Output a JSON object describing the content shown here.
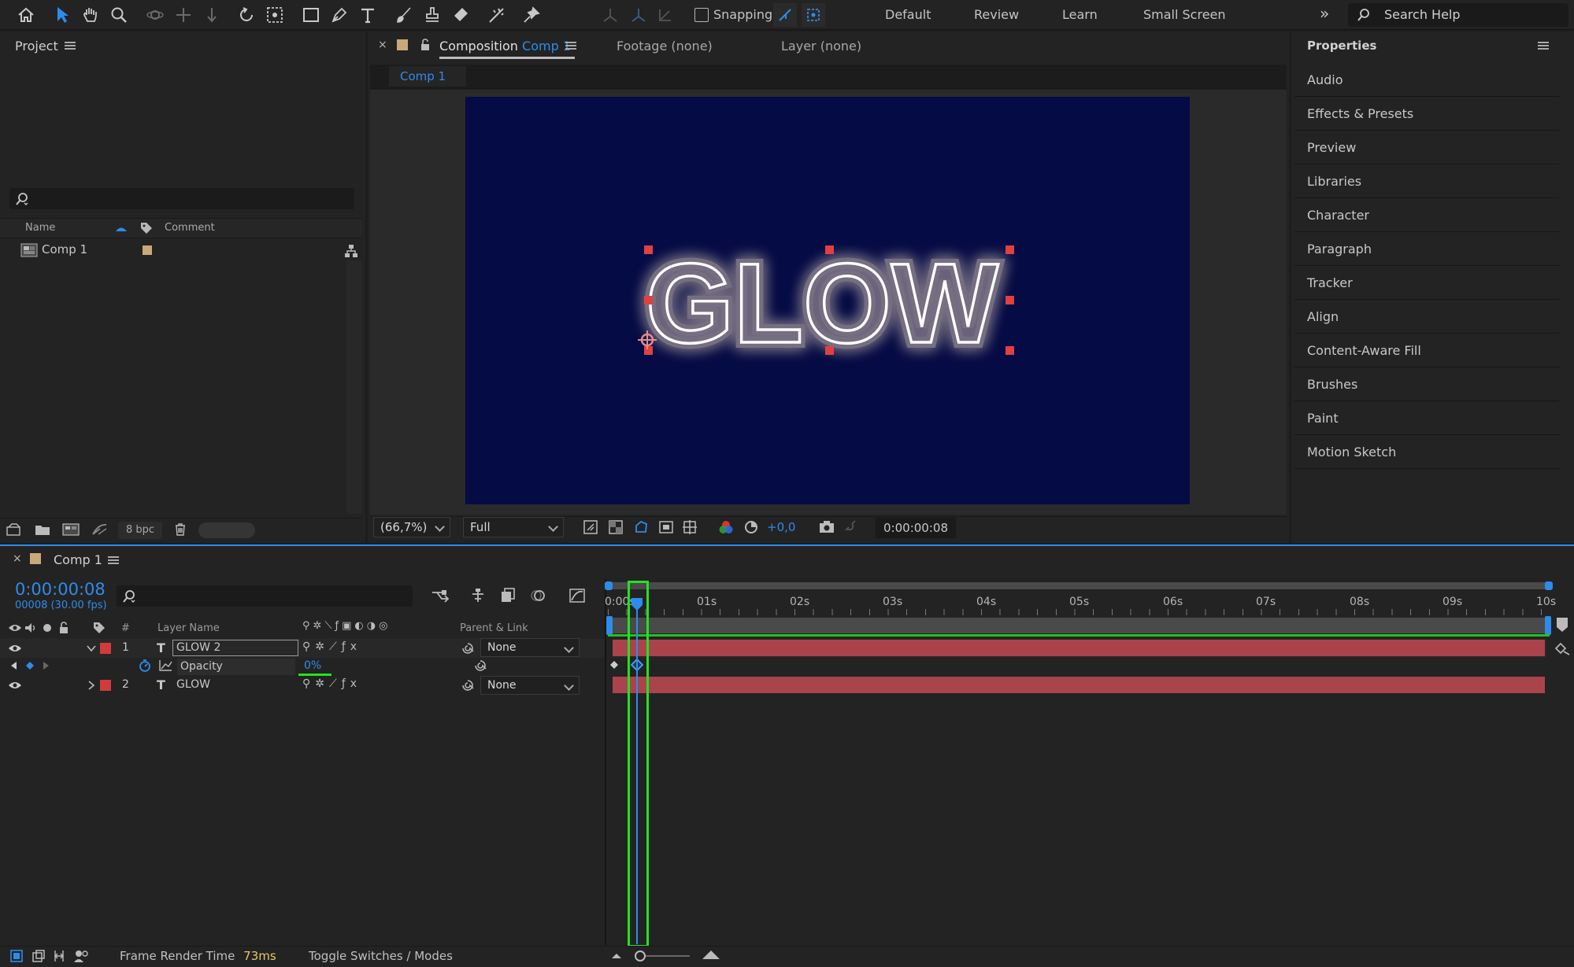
{
  "toolbar": {
    "snapping_label": "Snapping",
    "workspaces": [
      "Default",
      "Review",
      "Learn",
      "Small Screen"
    ],
    "search_placeholder": "Search Help"
  },
  "project": {
    "title": "Project",
    "col_name": "Name",
    "col_comment": "Comment",
    "items": [
      {
        "name": "Comp 1"
      }
    ],
    "bpc": "8 bpc"
  },
  "viewer": {
    "tab_prefix": "Composition",
    "tab_comp": "Comp 1",
    "footage_tab": "Footage (none)",
    "layer_tab": "Layer (none)",
    "sub_tab": "Comp 1",
    "glow_text": "GLOW",
    "zoom": "(66,7%)",
    "resolution": "Full",
    "exposure": "+0,0",
    "timecode": "0:00:00:08",
    "bg_color": "#050b44"
  },
  "properties": {
    "title": "Properties",
    "items": [
      "Audio",
      "Effects & Presets",
      "Preview",
      "Libraries",
      "Character",
      "Paragraph",
      "Tracker",
      "Align",
      "Content-Aware Fill",
      "Brushes",
      "Paint",
      "Motion Sketch"
    ]
  },
  "timeline": {
    "comp_name": "Comp 1",
    "timecode": "0:00:00:08",
    "frame_info": "00008 (30.00 fps)",
    "col_hash": "#",
    "col_layer_name": "Layer Name",
    "col_parent": "Parent & Link",
    "layers": [
      {
        "num": "1",
        "type": "T",
        "name": "GLOW 2",
        "parent": "None",
        "color": "#d23b3b"
      },
      {
        "num": "2",
        "type": "T",
        "name": "GLOW",
        "parent": "None",
        "color": "#d23b3b"
      }
    ],
    "opacity_label": "Opacity",
    "opacity_value": "0%",
    "ruler_labels": [
      "0:00s",
      "01s",
      "02s",
      "03s",
      "04s",
      "05s",
      "06s",
      "07s",
      "08s",
      "09s",
      "10s"
    ],
    "footer_render_label": "Frame Render Time",
    "footer_render_value": "73ms",
    "footer_toggle": "Toggle Switches / Modes"
  },
  "colors": {
    "accent": "#2d8ceb",
    "highlight_green": "#22e31e",
    "layer_bar": "#a9444d"
  }
}
